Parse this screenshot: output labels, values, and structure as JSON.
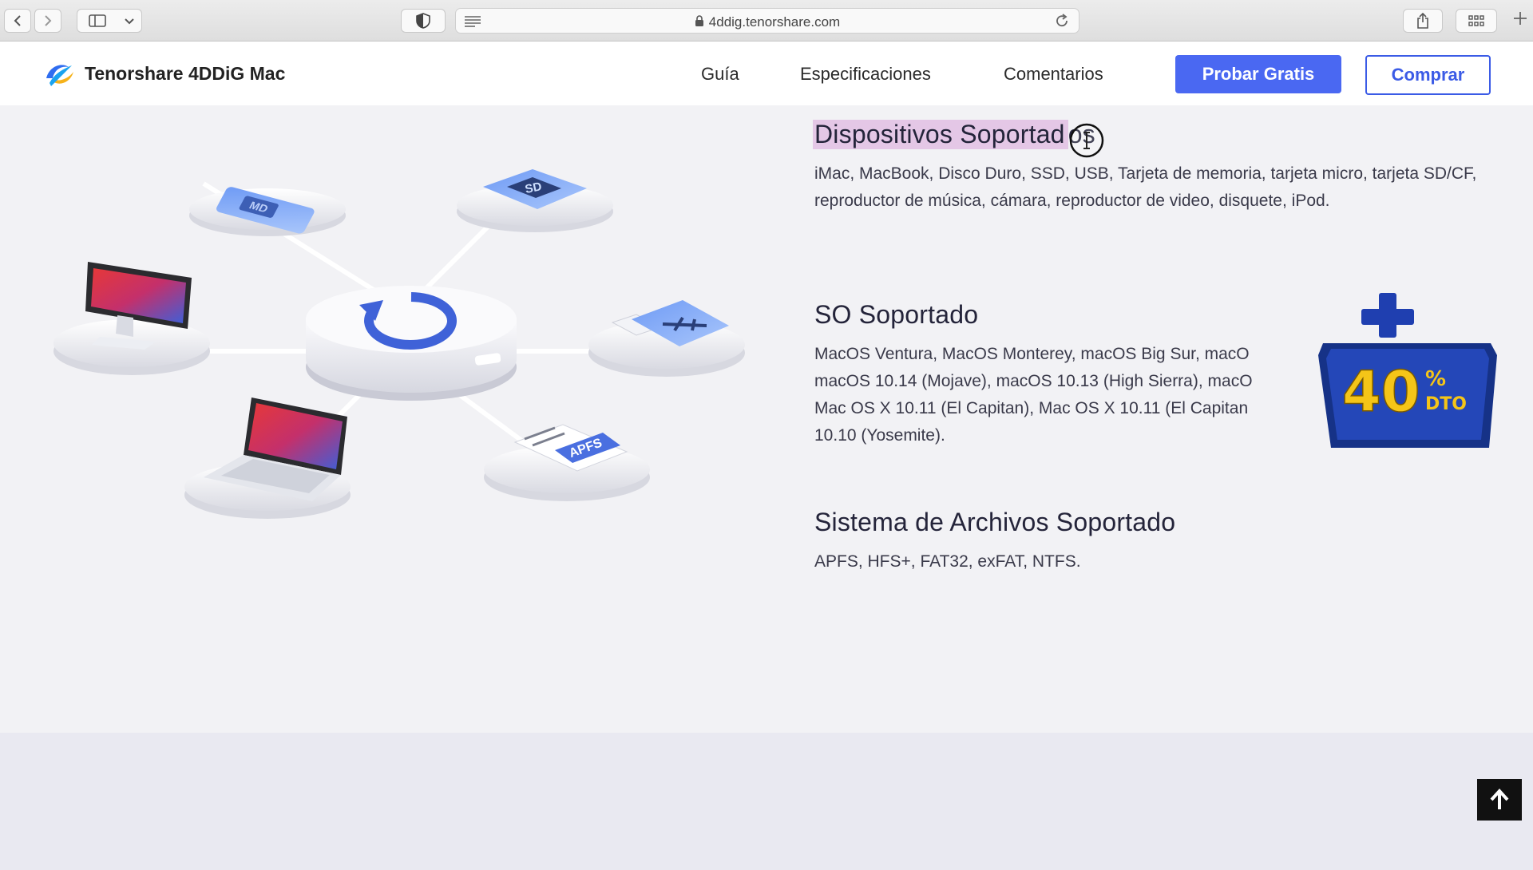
{
  "browser": {
    "url": "4ddig.tenorshare.com",
    "icons": [
      "chevron-left-icon",
      "chevron-right-icon",
      "sidebar-icon",
      "chevron-down-icon",
      "shield-icon",
      "reader-icon",
      "lock-icon",
      "reload-icon",
      "share-icon",
      "grid-icon",
      "plus-icon"
    ]
  },
  "header": {
    "logo_text": "Tenorshare 4DDiG Mac",
    "nav": [
      "Guía",
      "Especificaciones",
      "Comentarios"
    ],
    "cta_primary": "Probar Gratis",
    "cta_secondary": "Comprar"
  },
  "illustration": {
    "labels": {
      "md": "MD",
      "sd": "SD",
      "apfs": "APFS"
    }
  },
  "specs": {
    "devices": {
      "title_highlighted": "Dispositivos Soportad",
      "title_rest": "os",
      "text": "iMac, MacBook, Disco Duro, SSD, USB, Tarjeta de memoria, tarjeta micro, tarjeta SD/CF, reproductor de música, cámara, reproductor de video, disquete, iPod."
    },
    "os": {
      "title": "SO Soportado",
      "line1": "MacOS Ventura, MacOS Monterey, macOS Big Sur, macO",
      "line2": "macOS 10.14 (Mojave), macOS 10.13 (High Sierra), macO",
      "line3": "Mac OS X 10.11 (El Capitan), Mac OS X 10.11 (El Capitan",
      "line4": "10.10 (Yosemite)."
    },
    "filesystems": {
      "title": "Sistema de Archivos Soportado",
      "text": "APFS, HFS+, FAT32, exFAT, NTFS."
    }
  },
  "badge": {
    "value": "40",
    "percent": "%",
    "suffix": "DTO"
  },
  "colors": {
    "primary": "#4a68f2",
    "highlight": "#e4c7e6",
    "badge": "#1f3f9e",
    "badge_text": "#f5c518"
  }
}
